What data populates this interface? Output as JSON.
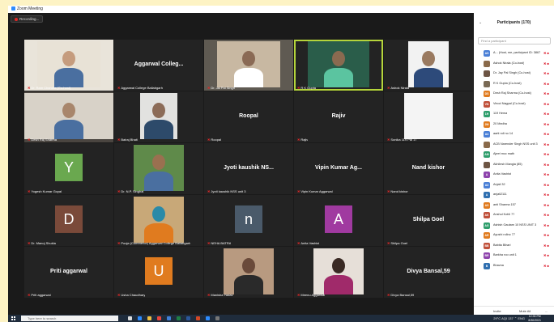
{
  "window": {
    "title": "Zoom Meeting"
  },
  "recording": {
    "label": "Recording..."
  },
  "tiles": [
    {
      "name": "Dr. Ram Chandra (Co-host)",
      "big": "",
      "avatar": ""
    },
    {
      "name": "Aggarwal College Ballabgarh",
      "big": "Aggarwal Colleg...",
      "avatar": ""
    },
    {
      "name": "Dr. Jai Pal Singh",
      "big": "",
      "avatar": ""
    },
    {
      "name": "R K Gupta",
      "big": "",
      "avatar": ""
    },
    {
      "name": "Ashok Nirala",
      "big": "",
      "avatar": ""
    },
    {
      "name": "Desh Raj Sharma",
      "big": "",
      "avatar": ""
    },
    {
      "name": "Balraj Bhati",
      "big": "",
      "avatar": ""
    },
    {
      "name": "Roopal",
      "big": "Roopal",
      "avatar": ""
    },
    {
      "name": "Rajiv",
      "big": "Rajiv",
      "avatar": ""
    },
    {
      "name": "Sonika 119 Pal 17",
      "big": "",
      "avatar": ""
    },
    {
      "name": "Yogesh Kumar Goyal",
      "big": "",
      "avatar": "Y"
    },
    {
      "name": "Dr. N.P. Singhal",
      "big": "",
      "avatar": ""
    },
    {
      "name": "Jyoti kaushik NSS unit 3",
      "big": "Jyoti kaushik NS...",
      "avatar": ""
    },
    {
      "name": "Vipin Kumar Aggarwal",
      "big": "Vipin Kumar Ag...",
      "avatar": ""
    },
    {
      "name": "Nand kishor",
      "big": "Nand kishor",
      "avatar": ""
    },
    {
      "name": "Dr. Manoj Shukla",
      "big": "",
      "avatar": "D"
    },
    {
      "name": "Pooja (Commerce) Aggarwal College Ballabgarh",
      "big": "",
      "avatar": ""
    },
    {
      "name": "NEHA BATRA",
      "big": "",
      "avatar": "n"
    },
    {
      "name": "Anita Vashist",
      "big": "",
      "avatar": "A"
    },
    {
      "name": "Shilpa Goel",
      "big": "Shilpa Goel",
      "avatar": ""
    },
    {
      "name": "Priti aggarwal",
      "big": "Priti aggarwal",
      "avatar": ""
    },
    {
      "name": "Usha Chaudhary",
      "big": "",
      "avatar": "U"
    },
    {
      "name": "Manisha Yadav",
      "big": "",
      "avatar": ""
    },
    {
      "name": "Meenu Aggarwal",
      "big": "",
      "avatar": ""
    },
    {
      "name": "Divya Bansal,59",
      "big": "Divya Bansal,59",
      "avatar": ""
    }
  ],
  "panel": {
    "title": "Participants (170)",
    "search_placeholder": "Find a participant",
    "participants": [
      {
        "initials": "AS",
        "color": "#4a7fd6",
        "name": "A... (Host, me, participant ID: 386706...)"
      },
      {
        "initials": "",
        "color": "#8a6a4a",
        "name": "Ashok Nirala (Co-host)"
      },
      {
        "initials": "",
        "color": "#6d5544",
        "name": "Dr. Jay Pal Singh (Co-host)"
      },
      {
        "initials": "",
        "color": "#7a6a55",
        "name": "R K Gupta (Co-host)"
      },
      {
        "initials": "DS",
        "color": "#e07b1f",
        "name": "Desh Raj Sharma (Co-host)"
      },
      {
        "initials": "VN",
        "color": "#c0503a",
        "name": "Vinod Nagpal (Co-host)"
      },
      {
        "initials": "1H",
        "color": "#2f9e6c",
        "name": "119 Hema"
      },
      {
        "initials": "2M",
        "color": "#e07b1f",
        "name": "20 Medha"
      },
      {
        "initials": "A4",
        "color": "#4a7fd6",
        "name": "aarti roll no 14"
      },
      {
        "initials": "",
        "color": "#8a6a4a",
        "name": "ACB Narender Singh NSS unit 3"
      },
      {
        "initials": "AM",
        "color": "#2f9e6c",
        "name": "Ajeet mcc math"
      },
      {
        "initials": "",
        "color": "#6d5544",
        "name": "Akhilesh Mangla (85)"
      },
      {
        "initials": "A",
        "color": "#8e44ad",
        "name": "Anita Vashist"
      },
      {
        "initials": "A3",
        "color": "#4a7fd6",
        "name": "Anjali 32"
      },
      {
        "initials": "A",
        "color": "#2f6fb0",
        "name": "anjali2111"
      },
      {
        "initials": "AS",
        "color": "#e07b1f",
        "name": "anti Sharma 157"
      },
      {
        "initials": "AK",
        "color": "#c0503a",
        "name": "Anshul Kohli 77"
      },
      {
        "initials": "AG",
        "color": "#2f9e6c",
        "name": "Ashish Gautam 10 NSS UNIT 3"
      },
      {
        "initials": "AR",
        "color": "#e07b1f",
        "name": "Ayushi rollno 77"
      },
      {
        "initials": "BB",
        "color": "#c0503a",
        "name": "Babita Bihari"
      },
      {
        "initials": "BR",
        "color": "#8e44ad",
        "name": "Barkha roo unit 1"
      },
      {
        "initials": "B",
        "color": "#2f6fb0",
        "name": "Bhavna"
      }
    ],
    "footer": {
      "invite": "Invite",
      "mute_all": "Mute All",
      "more": "..."
    }
  },
  "taskbar": {
    "search_placeholder": "Type here to search",
    "weather": "29°C  AQI 137",
    "lang": "ENG",
    "time": "12:33 PM",
    "date": "8/30/2021"
  }
}
